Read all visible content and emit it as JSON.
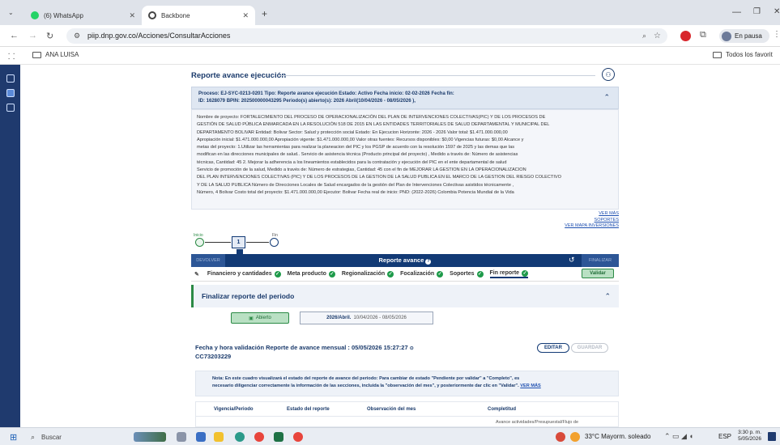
{
  "browser": {
    "tabs": [
      {
        "label": "(6) WhatsApp"
      },
      {
        "label": "Backbone"
      }
    ],
    "url": "piip.dnp.gov.co/Acciones/ConsultarAcciones",
    "profile_status": "En pausa",
    "bookmark_folder": "ANA LUISA",
    "all_favorites": "Todos los favorit"
  },
  "header": {
    "title": "Reporte avance ejecución"
  },
  "process": {
    "line1": "Proceso: EJ-SYC-0213-0201 Tipo: Reporte avance ejecución Estado: Activo Fecha inicio: 02-02-2026 Fecha fin:",
    "line2": "ID: 1628079 BPIN: 202500000043295 Periodo(s) abierto(s): 2026 Abril(10/04/2026 - 08/05/2026 ),"
  },
  "project": {
    "lines": [
      "Nombre de proyecto: FORTALECIMIENTO DEL PROCESO DE OPERACIONALIZACIÓN DEL PLAN DE INTERVENCIONES COLECTIVAS(PIC) Y DE LOS PROCESOS DE",
      "GESTIÓN DE SALUD PÚBLICA ENMARCADA EN LA RESOLUCIÓN 518 DE 2015 EN LAS ENTIDADES TERRITORIALES DE SALUD DEPARTAMENTAL Y MUNICIPAL DEL",
      "DEPARTAMENTO BOLIVAR Entidad: Bolivar Sector: Salud y protección social Estado: En Ejecucion Horizonte: 2026 - 2026 Valor total: $1.471.000.000,00",
      "Apropiación inicial: $1.471.000.000,00 Apropiación vigente: $1.471.000.000,00 Valor otras fuentes: Recursos disponibles: $0,00 Vigencias futuras: $0,00 Alcance y",
      "metas del proyecto: 1.Utilizar las herramientas para realizar la planeacion del PIC y los PGSP de acuerdo con la resolución 1597 de 2025 y las demas que las",
      "modifican en las direcciones municipales de salud.. Servicio de asistencia técnica (Producto principal del proyecto) , Medido a través de: Número de asistencias",
      "técnicas, Cantidad: 45 2. Mejorar la adherencia a los lineamientos establecidos para la contratación y ejecución del PIC en el ente departamental de salud",
      "Servicio de promoción de la salud, Medido a través de: Número de estrategias, Cantidad: 45 con el fin de MEJORAR LA GESTION EN LA OPERACIONALIZACION",
      "DEL PLAN INTERVENCIONES COLECTIVAS (PIC) Y DE LOS PROCESOS DE LA GESTION DE LA SALUD PUBLICA EN EL MARCO DE LA GESTION DEL RIESGO COLECTIVO",
      "Y DE LA SALUD PUBLICA Número de Direcciones Locales de Salud encargados de la gestión del Plan de Intervenciones Colectivas asistidos técnicamente ,",
      "Número, 4 Bolivar Costo total del proyecto: $1.471.000.000,00 Ejecutor: Bolivar Fecha real de inicio: PND: (2022-2026) Colombia Potencia Mundial de la Vida"
    ],
    "links": [
      "VER MÁS",
      "SOPORTES",
      "VER MAPA INVERSIONES"
    ]
  },
  "flow": {
    "start_label": "Inicio",
    "step_number": "1",
    "end_label": "Fin"
  },
  "stepbar": {
    "devolver": "DEVOLVER",
    "title": "Reporte avance",
    "finalizar": "FINALIZAR"
  },
  "tabs": [
    {
      "label": "Financiero y cantidades"
    },
    {
      "label": "Meta producto"
    },
    {
      "label": "Regionalización"
    },
    {
      "label": "Focalización"
    },
    {
      "label": "Soportes"
    },
    {
      "label": "Fin reporte"
    }
  ],
  "validar_label": "Validar",
  "finalizar_section": {
    "title": "Finalizar reporte del periodo",
    "status": "Abierto",
    "period_bold": "2026/Abril.",
    "period_range": "10/04/2026 - 08/05/2026"
  },
  "validation": {
    "line1": "Fecha y hora validación Reporte de avance mensual : 05/05/2026 15:27:27",
    "line2": "CC73203229",
    "edit_label": "EDITAR",
    "save_label": "GUARDAR"
  },
  "note": {
    "line1": "Nota: En este cuadro visualizará el estado del reporte de avance del periodo: Para cambiar de estado \"Pendiente por validar\" a \"Completo\", es",
    "line2": "necesario diligenciar correctamente la información de las secciones, incluida la \"observación del mes\", y posteriormente dar clic en \"Validar\".",
    "link": "VER MÁS"
  },
  "table": {
    "headers": [
      "Vigencia/Periodo",
      "Estado del reporte",
      "Observación del mes",
      "Completitud"
    ],
    "sub": "Avance actividades/Presupuestal/Flujo de"
  },
  "taskbar": {
    "search": "Buscar",
    "weather": "33°C  Mayorm. soleado",
    "lang": "ESP",
    "time": "3:30 p. m.",
    "date": "5/05/2026"
  },
  "colors": {
    "accent": "#123a75",
    "success": "#2b8a45"
  }
}
